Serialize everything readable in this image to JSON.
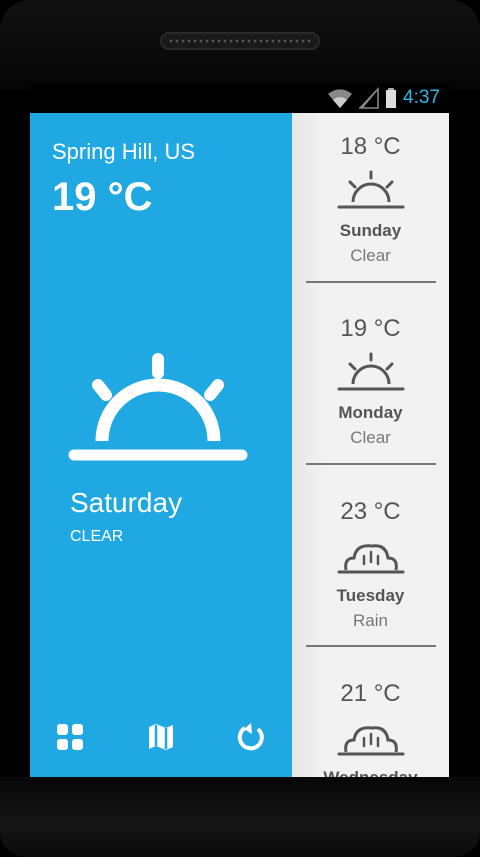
{
  "status": {
    "time": "4:37",
    "accent": "#33b5e5"
  },
  "current": {
    "location": "Spring Hill, US",
    "temperature": "19 °C",
    "day": "Saturday",
    "condition": "CLEAR",
    "icon": "sunrise-icon",
    "background": "#1fa8e1"
  },
  "toolbar": {
    "icons": [
      "grid-icon",
      "map-icon",
      "refresh-icon"
    ]
  },
  "forecast": [
    {
      "temperature": "18 °C",
      "day": "Sunday",
      "condition": "Clear",
      "icon": "sunrise-icon"
    },
    {
      "temperature": "19 °C",
      "day": "Monday",
      "condition": "Clear",
      "icon": "sunrise-icon"
    },
    {
      "temperature": "23 °C",
      "day": "Tuesday",
      "condition": "Rain",
      "icon": "cloud-icon"
    },
    {
      "temperature": "21 °C",
      "day": "Wednesday",
      "condition": "",
      "icon": "cloud-icon"
    }
  ]
}
